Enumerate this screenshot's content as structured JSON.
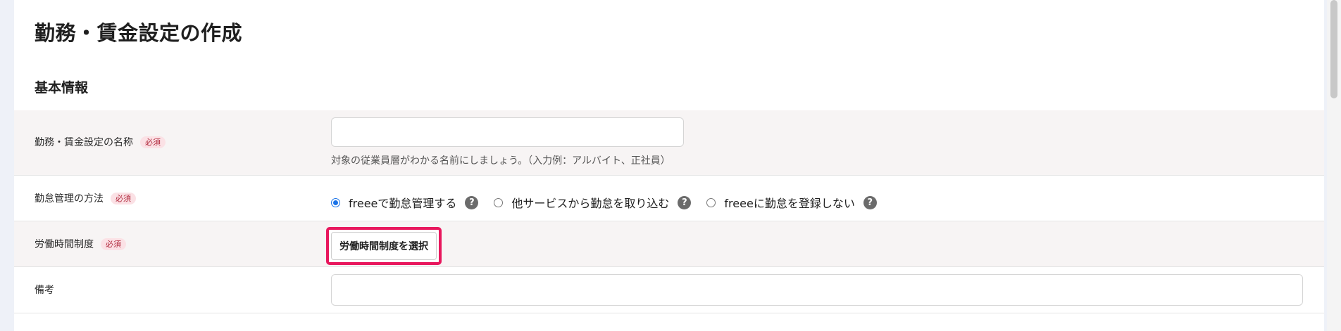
{
  "header": {
    "title": "勤務・賃金設定の作成"
  },
  "section": {
    "title": "基本情報"
  },
  "form": {
    "required_label": "必須",
    "name_field": {
      "label": "勤務・賃金設定の名称",
      "value": "",
      "hint": "対象の従業員層がわかる名前にしましょう。（入力例：アルバイト、正社員）"
    },
    "attendance_method": {
      "label": "勤怠管理の方法",
      "options": [
        {
          "label": "freeeで勤怠管理する",
          "checked": true
        },
        {
          "label": "他サービスから勤怠を取り込む",
          "checked": false
        },
        {
          "label": "freeeに勤怠を登録しない",
          "checked": false
        }
      ],
      "help_symbol": "?"
    },
    "working_hours_system": {
      "label": "労働時間制度",
      "button_label": "労働時間制度を選択"
    },
    "remarks": {
      "label": "備考",
      "value": ""
    }
  },
  "colors": {
    "highlight_border": "#e8175d",
    "radio_accent": "#1a73e8",
    "required_text": "#b0283c",
    "required_bg": "#fbe1e5"
  }
}
